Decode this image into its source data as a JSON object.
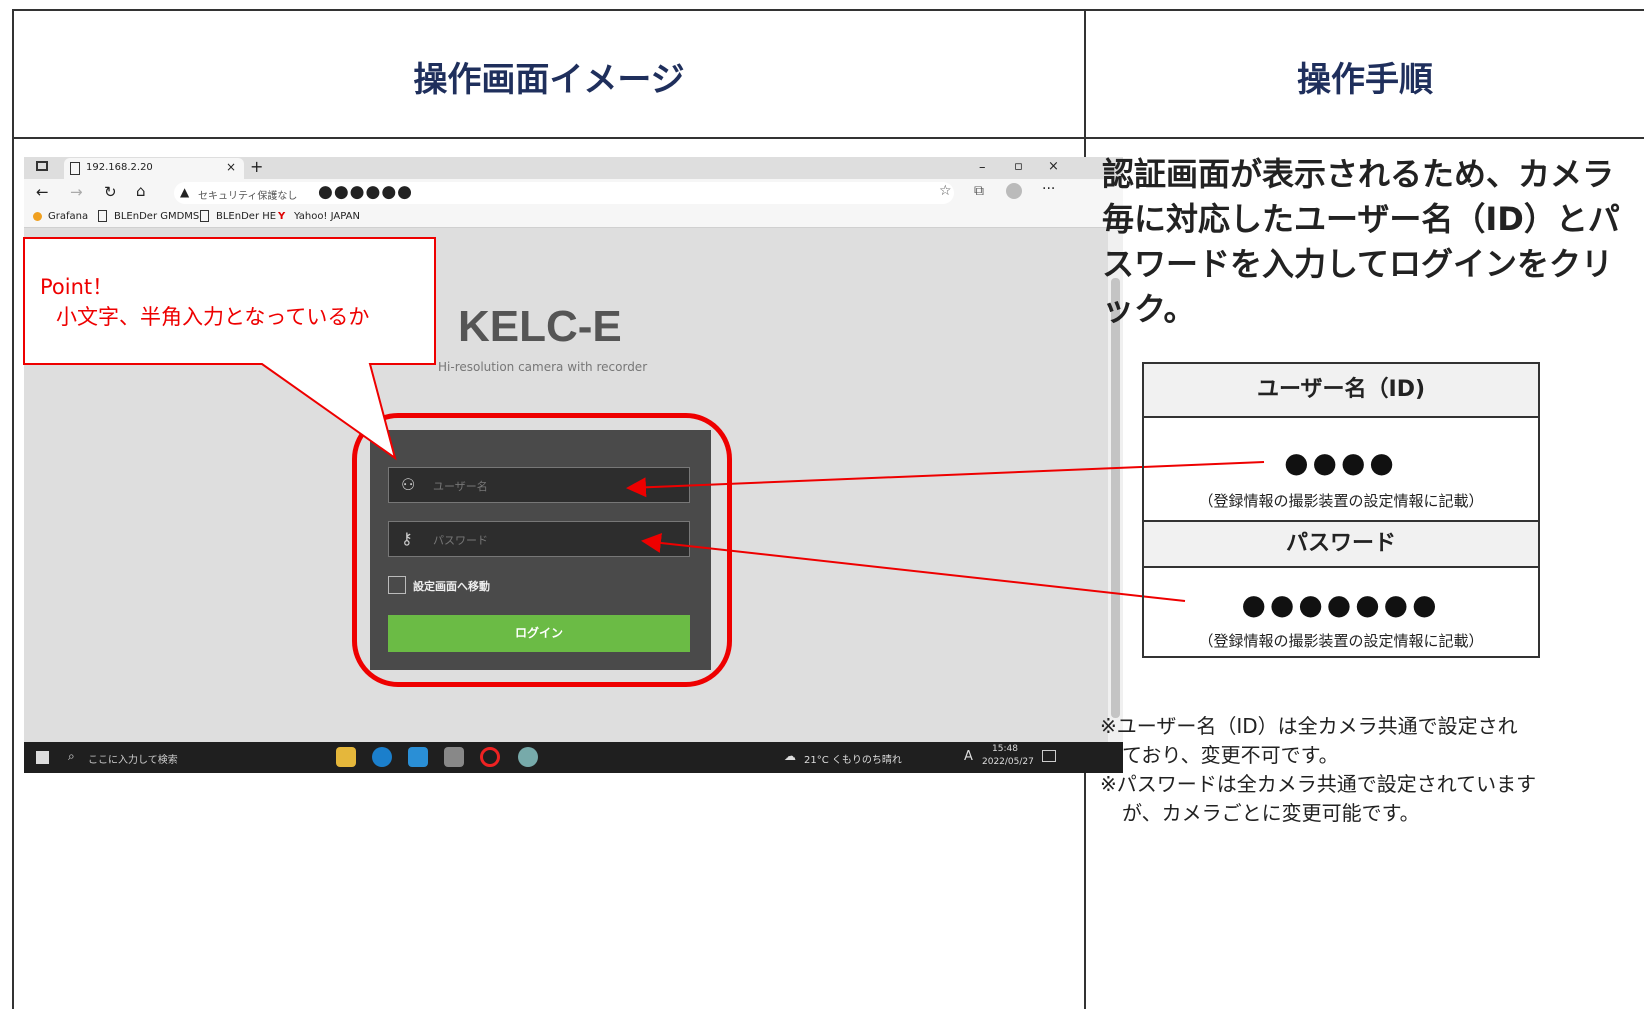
{
  "header": {
    "left_title": "操作画面イメージ",
    "right_title": "操作手順"
  },
  "browser": {
    "tab_title": "192.168.2.20",
    "tab_close": "×",
    "tab_new": "+",
    "window_controls": [
      "–",
      "▫",
      "×"
    ],
    "security_label": "セキュリティ保護なし",
    "url_masked": "●●●●●●",
    "bookmarks": [
      "Grafana",
      "BLEnDer GMDMS",
      "BLEnDer HE",
      "Yahoo! JAPAN"
    ]
  },
  "login_page": {
    "brand": "KELC-E",
    "brand_sub": "Hi-resolution camera with recorder",
    "username_placeholder": "ユーザー名",
    "password_placeholder": "パスワード",
    "checkbox_label": "設定画面へ移動",
    "login_button": "ログイン"
  },
  "taskbar": {
    "search_placeholder": "ここに入力して検索",
    "weather": "21°C くもりのち晴れ",
    "ime": "A",
    "time": "15:48",
    "date": "2022/05/27"
  },
  "callout": {
    "line1": "Point！",
    "line2": "小文字、半角入力となっているか"
  },
  "instructions": {
    "text": "認証画面が表示されるため、カメラ毎に対応したユーザー名（ID）とパスワードを入力してログインをクリック。"
  },
  "credentials": {
    "user_header": "ユーザー名（ID)",
    "user_value": "●●●●",
    "user_note": "（登録情報の撮影装置の設定情報に記載）",
    "pass_header": "パスワード",
    "pass_value": "●●●●●●●",
    "pass_note": "（登録情報の撮影装置の設定情報に記載）"
  },
  "notes": {
    "n1a": "※ユーザー名（ID）は全カメラ共通で設定され",
    "n1b": "ており、変更不可です。",
    "n2a": "※パスワードは全カメラ共通で設定されています",
    "n2b": "が、カメラごとに変更可能です。"
  }
}
